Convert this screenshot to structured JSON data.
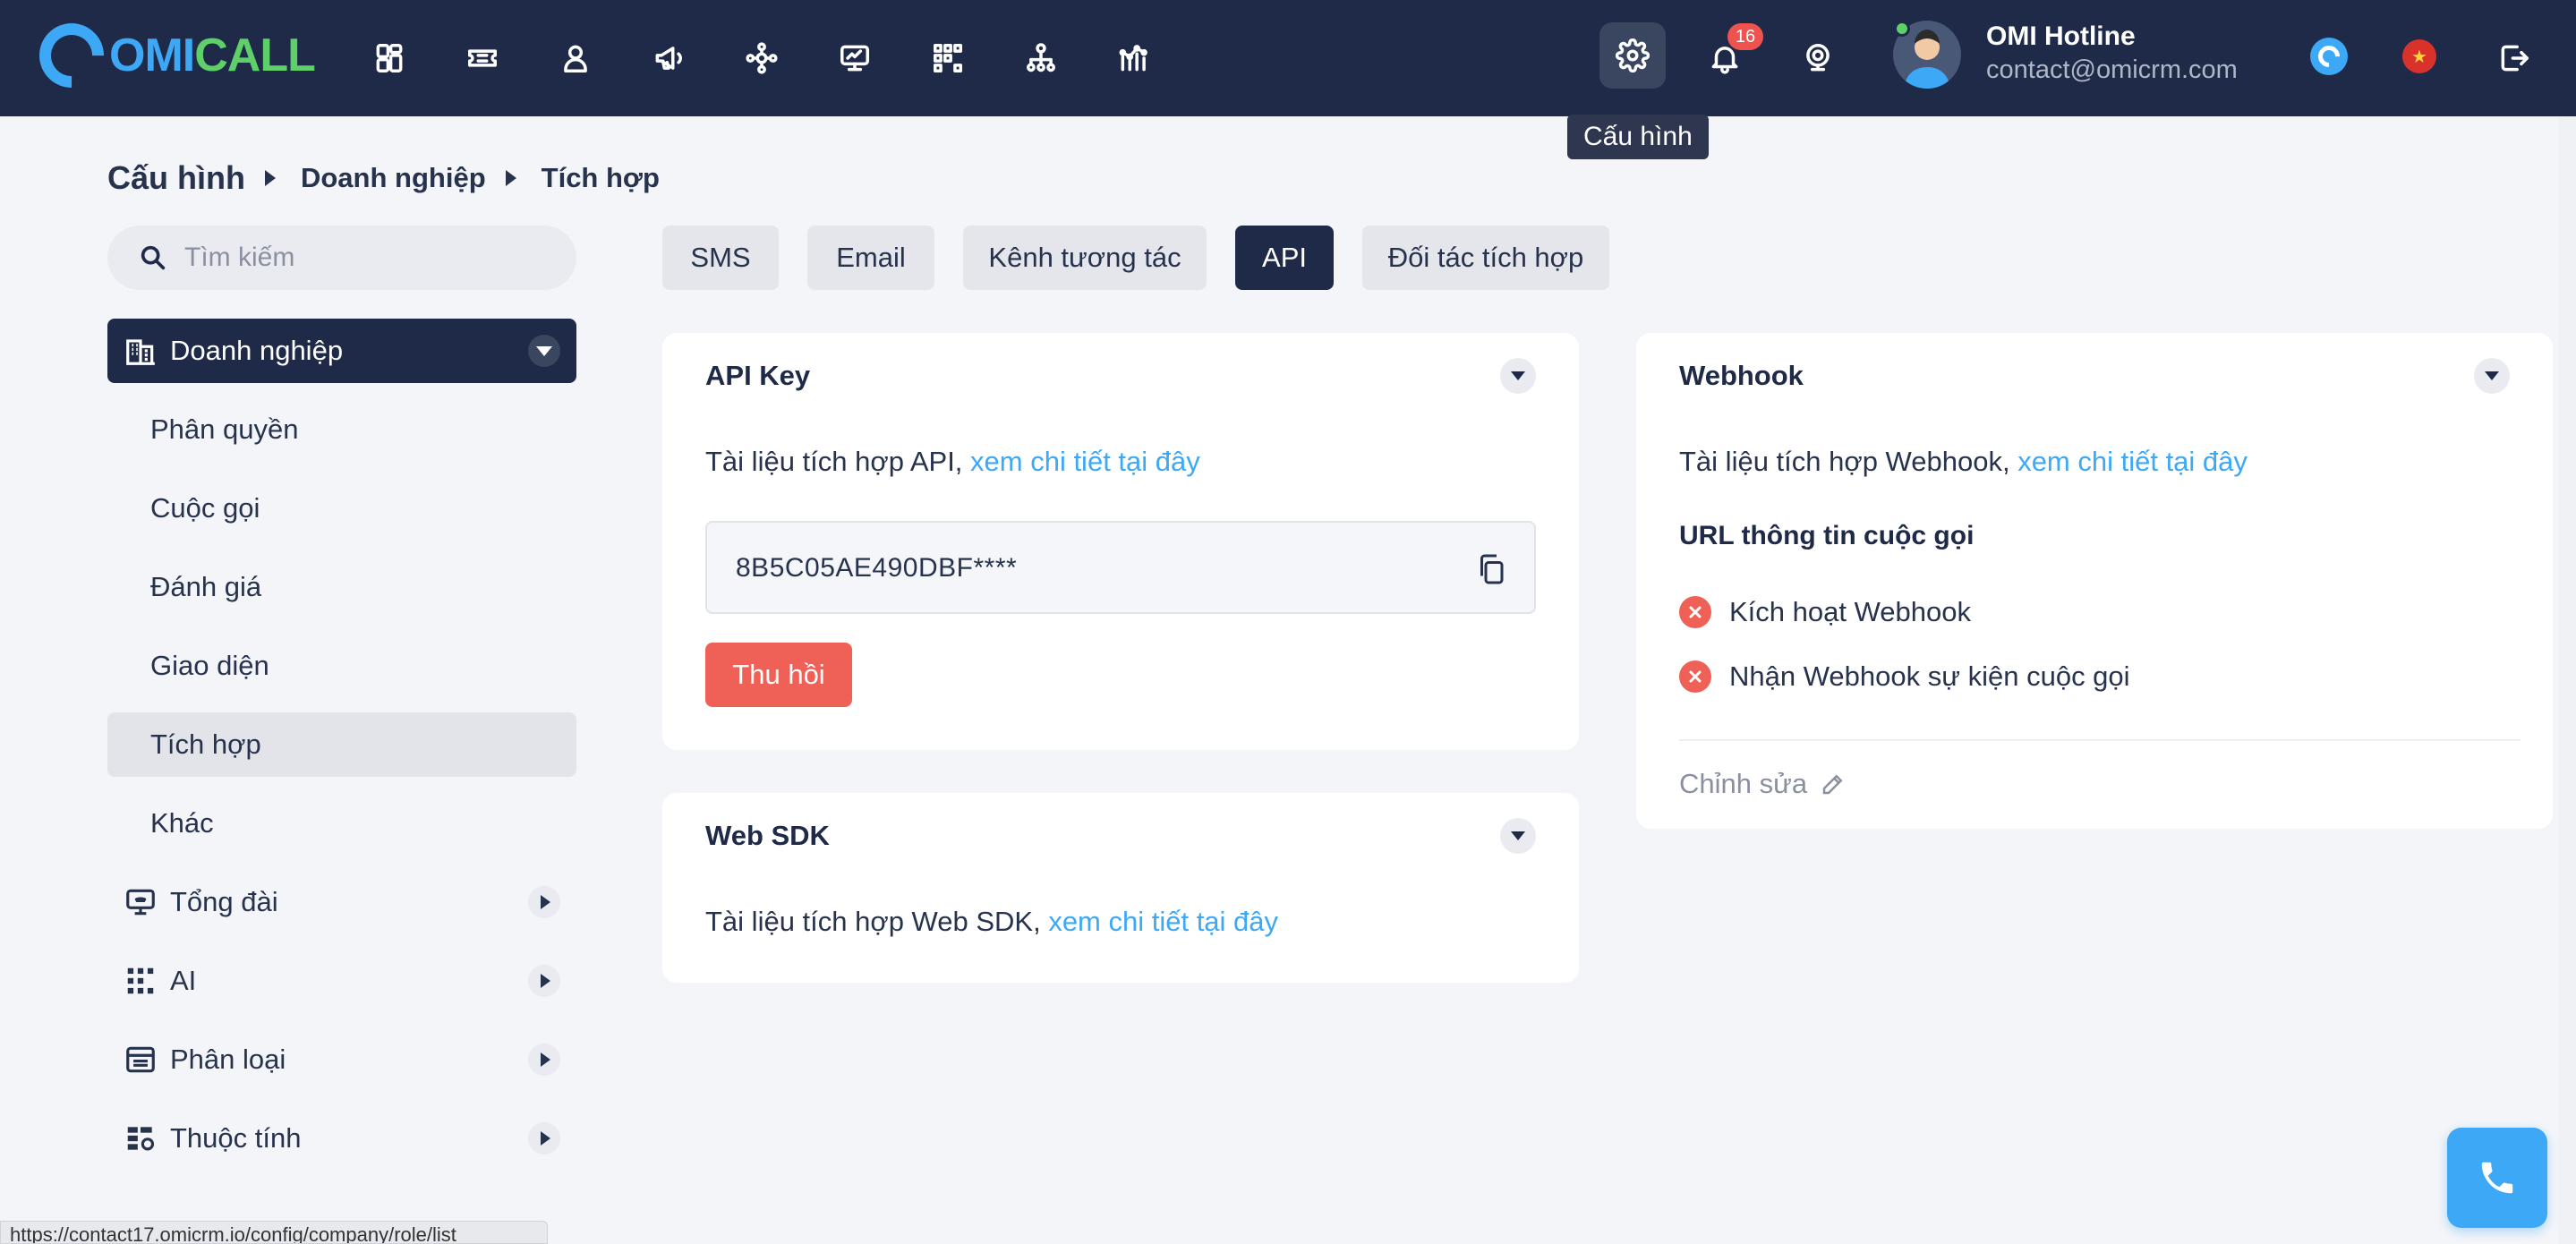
{
  "header": {
    "logo": {
      "part1": "OMI",
      "part2": "CALL"
    },
    "nav_icons": [
      "dashboard-icon",
      "ticket-icon",
      "user-icon",
      "megaphone-icon",
      "integration-icon",
      "monitor-icon",
      "apps-icon",
      "organization-icon",
      "analytics-icon"
    ],
    "notification_count": "16",
    "user_name": "OMI Hotline",
    "user_email": "contact@omicrm.com",
    "settings_tooltip": "Cấu hình"
  },
  "breadcrumb": {
    "root": "Cấu hình",
    "level1": "Doanh nghiệp",
    "level2": "Tích hợp"
  },
  "sidebar": {
    "search_placeholder": "Tìm kiếm",
    "active_group": "Doanh nghiệp",
    "sub_items": [
      "Phân quyền",
      "Cuộc gọi",
      "Đánh giá",
      "Giao diện",
      "Tích hợp",
      "Khác"
    ],
    "selected_sub_item": "Tích hợp",
    "groups": [
      "Tổng đài",
      "AI",
      "Phân loại",
      "Thuộc tính"
    ]
  },
  "tabs": [
    "SMS",
    "Email",
    "Kênh tương tác",
    "API",
    "Đối tác tích hợp"
  ],
  "active_tab": "API",
  "api_key_card": {
    "title": "API Key",
    "doc_text": "Tài liệu tích hợp API, ",
    "doc_link": "xem chi tiết tại đây",
    "key_value": "8B5C05AE490DBF****",
    "revoke_label": "Thu hồi"
  },
  "web_sdk_card": {
    "title": "Web SDK",
    "doc_text": "Tài liệu tích hợp Web SDK, ",
    "doc_link": "xem chi tiết tại đây"
  },
  "webhook_card": {
    "title": "Webhook",
    "doc_text": "Tài liệu tích hợp Webhook, ",
    "doc_link": "xem chi tiết tại đây",
    "subtitle": "URL thông tin cuộc gọi",
    "options": [
      "Kích hoạt Webhook",
      "Nhận Webhook sự kiện cuộc gọi"
    ],
    "edit_label": "Chỉnh sửa"
  },
  "status_bar_url": "https://contact17.omicrm.io/config/company/role/list",
  "colors": {
    "navy": "#1f2a48",
    "accent_blue": "#3da8f5",
    "logo_green": "#5fcf6a",
    "danger_red": "#ef6157",
    "badge_red": "#ef5350"
  }
}
